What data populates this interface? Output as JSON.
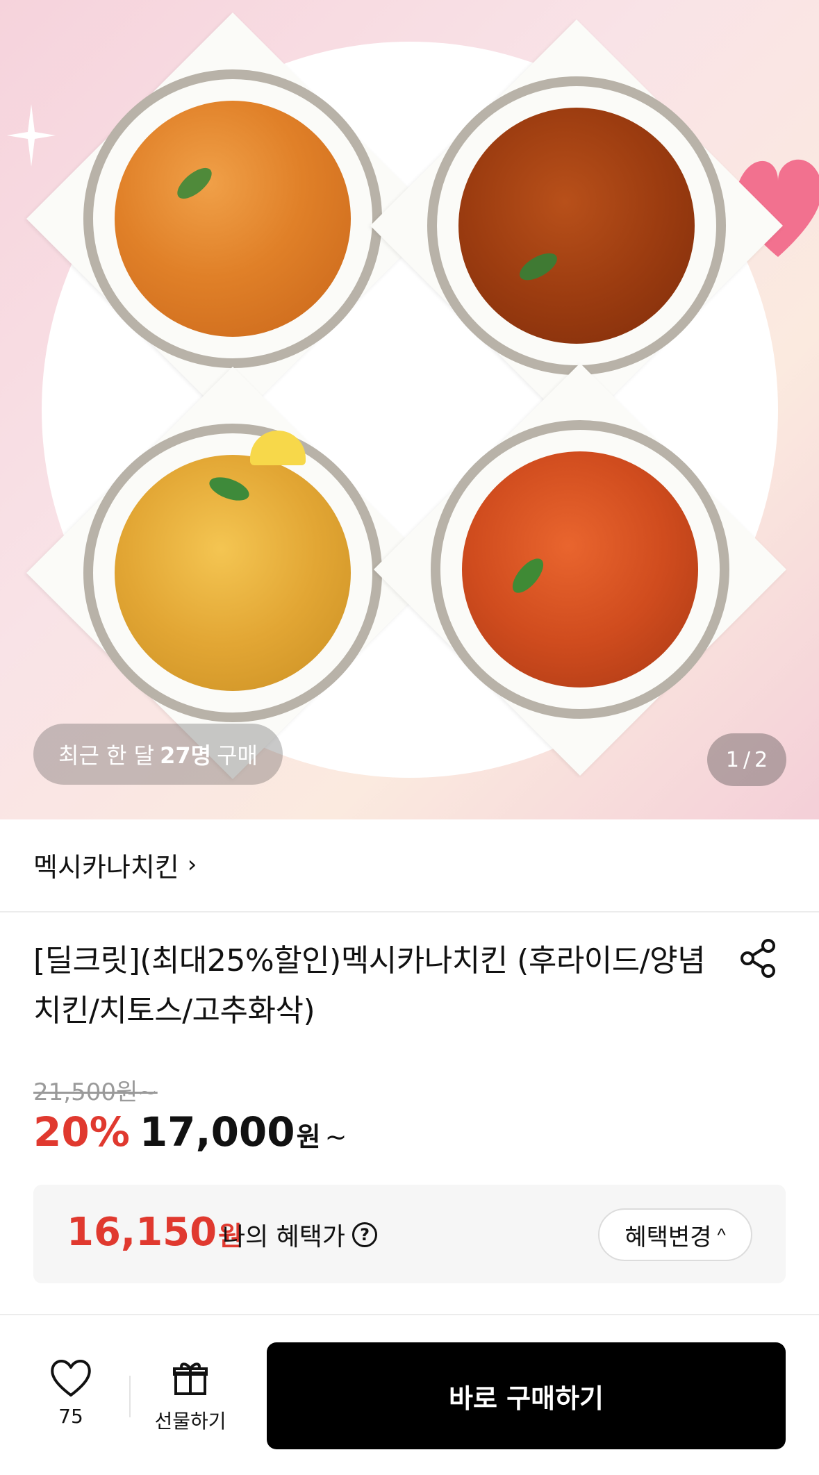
{
  "hero": {
    "buyers_prefix": "최근 한 달",
    "buyers_count": "27명",
    "buyers_suffix": "구매",
    "page_current": "1",
    "page_separator": "/",
    "page_total": "2"
  },
  "product": {
    "brand": "멕시카나치킨",
    "brand_chevron": "›",
    "title": "[딜크릿](최대25%할인)멕시카나치킨 (후라이드/양념치킨/치토스/고추화삭)"
  },
  "pricing": {
    "original_price": "21,500원~",
    "discount_rate": "20%",
    "sale_price": "17,000",
    "currency": "원",
    "tilde": "~"
  },
  "benefit": {
    "price": "16,150",
    "currency": "원",
    "label": "나의 혜택가",
    "help_glyph": "?",
    "change_label": "혜택변경",
    "change_chevron": "^"
  },
  "bottom_bar": {
    "like_count": "75",
    "gift_label": "선물하기",
    "buy_label": "바로 구매하기"
  },
  "icons": {
    "share": "share-icon",
    "heart": "heart-icon",
    "gift": "gift-icon",
    "help": "question-circle-icon"
  },
  "colors": {
    "discount_red": "#e0392f",
    "buy_button_bg": "#000000",
    "benefit_box_bg": "#f6f6f6"
  }
}
